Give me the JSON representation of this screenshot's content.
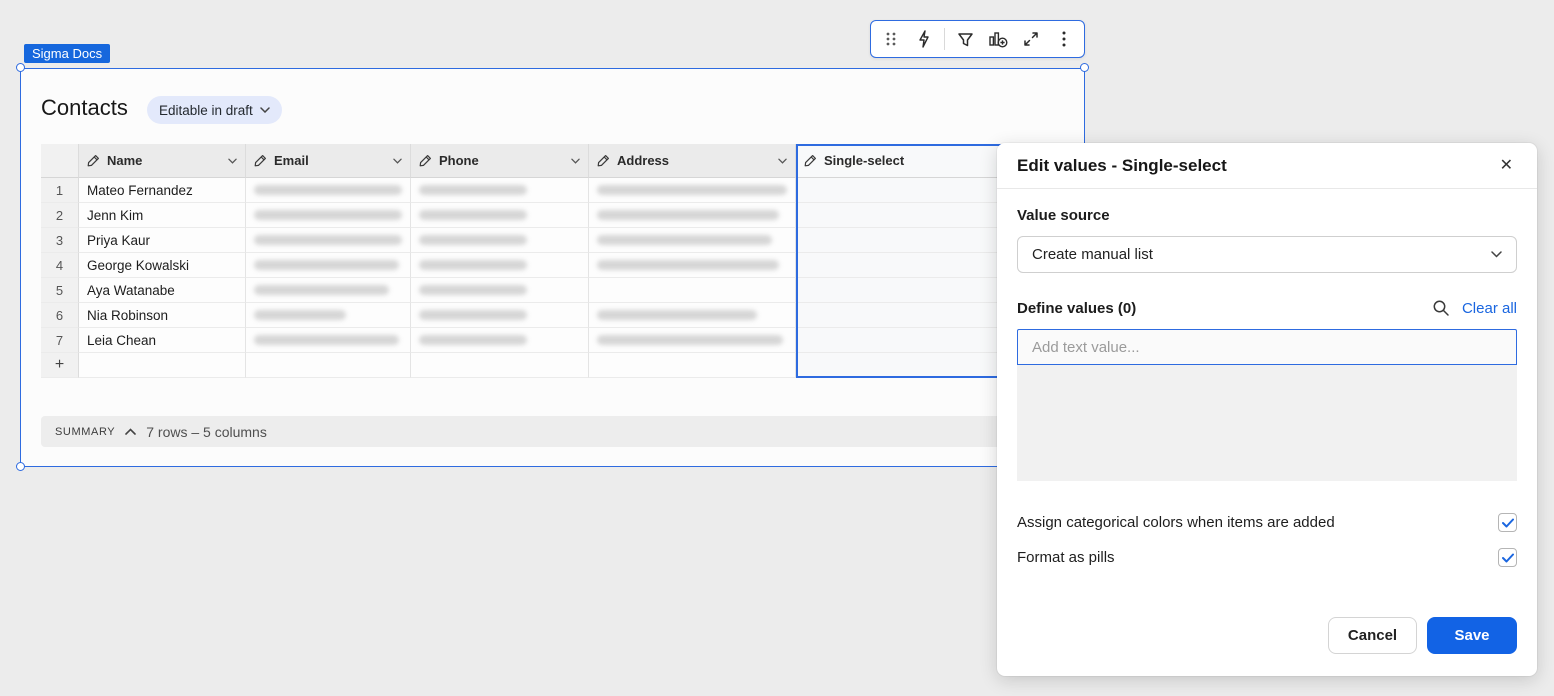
{
  "badge": {
    "label": "Sigma Docs"
  },
  "toolbar": {
    "icons": [
      "drag-handle",
      "lightning",
      "filter",
      "add-chart",
      "maximize",
      "more-menu"
    ]
  },
  "widget": {
    "title": "Contacts",
    "mode_pill": "Editable in draft",
    "table": {
      "columns": [
        {
          "label": "Name",
          "selected": false
        },
        {
          "label": "Email",
          "selected": false
        },
        {
          "label": "Phone",
          "selected": false
        },
        {
          "label": "Address",
          "selected": false
        },
        {
          "label": "Single-select",
          "selected": true
        }
      ],
      "rows": [
        {
          "num": "1",
          "name": "Mateo Fernandez",
          "email_w": 152,
          "phone_w": 108,
          "addr_w": 190
        },
        {
          "num": "2",
          "name": "Jenn Kim",
          "email_w": 150,
          "phone_w": 108,
          "addr_w": 182
        },
        {
          "num": "3",
          "name": "Priya Kaur",
          "email_w": 152,
          "phone_w": 108,
          "addr_w": 175
        },
        {
          "num": "4",
          "name": "George Kowalski",
          "email_w": 145,
          "phone_w": 108,
          "addr_w": 182
        },
        {
          "num": "5",
          "name": "Aya Watanabe",
          "email_w": 135,
          "phone_w": 108,
          "addr_w": 0
        },
        {
          "num": "6",
          "name": "Nia Robinson",
          "email_w": 92,
          "phone_w": 108,
          "addr_w": 160
        },
        {
          "num": "7",
          "name": "Leia Chean",
          "email_w": 145,
          "phone_w": 108,
          "addr_w": 186
        }
      ],
      "add_row_label": "+"
    },
    "summary": {
      "label": "SUMMARY",
      "info": "7 rows – 5 columns"
    }
  },
  "panel": {
    "title": "Edit values - Single-select",
    "close_label": "✕",
    "value_source": {
      "label": "Value source",
      "selected": "Create manual list"
    },
    "define_values": {
      "label": "Define values (0)",
      "clear_all": "Clear all",
      "input_placeholder": "Add text value..."
    },
    "checkboxes": [
      {
        "label": "Assign categorical colors when items are added",
        "checked": true
      },
      {
        "label": "Format as pills",
        "checked": true
      }
    ],
    "cancel_label": "Cancel",
    "save_label": "Save"
  },
  "colors": {
    "accent_blue": "#2e6be0",
    "save_blue": "#1263e5",
    "badge_blue": "#1667dd",
    "pill_bg": "#e3e9fb",
    "canvas_bg": "#ececec"
  }
}
